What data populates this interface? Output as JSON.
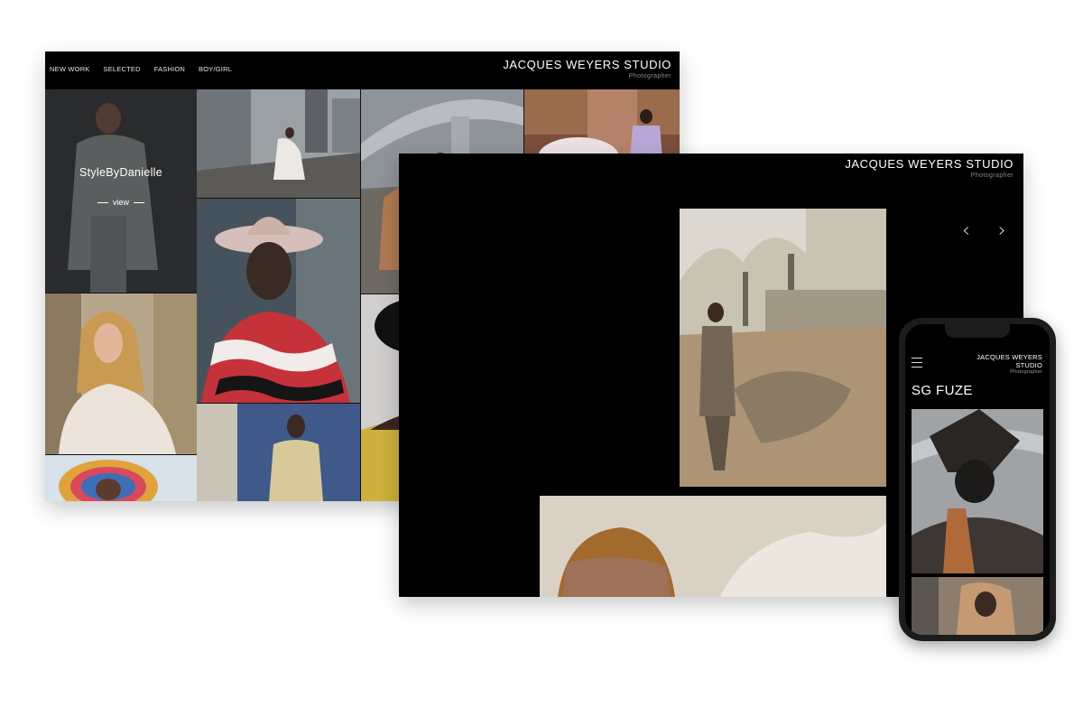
{
  "desktop": {
    "nav": [
      "NEW WORK",
      "SELECTED",
      "FASHION",
      "BOY/GIRL"
    ],
    "brand_title": "JACQUES WEYERS STUDIO",
    "brand_subtitle": "Photographer",
    "feature": {
      "title": "StyleByDanielle",
      "view_label": "view"
    }
  },
  "slideshow": {
    "brand_title": "JACQUES WEYERS STUDIO",
    "brand_subtitle": "Photographer",
    "prev_icon": "chevron-left-icon",
    "next_icon": "chevron-right-icon"
  },
  "phone": {
    "brand_line1": "JACQUES WEYERS",
    "brand_line2": "STUDIO",
    "brand_subtitle": "Photographer",
    "page_title": "SG FUZE",
    "menu_icon": "hamburger-menu-icon"
  }
}
